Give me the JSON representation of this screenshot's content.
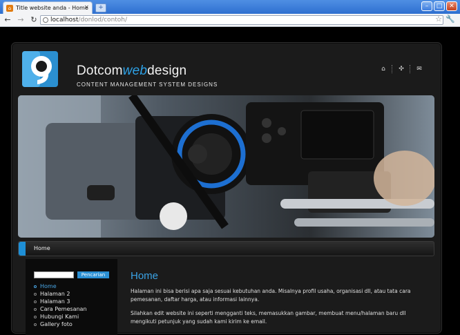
{
  "browser": {
    "tab_title": "Title website anda - Home",
    "tab_close": "×",
    "new_tab": "+",
    "url_host": "localhost",
    "url_path": "/donlod/contoh/",
    "back": "←",
    "forward": "→",
    "reload": "↻",
    "star": "☆",
    "wrench": "🔧",
    "minimize": "–",
    "maximize": "□",
    "close": "✕"
  },
  "site": {
    "brand_pre": "Dotcom",
    "brand_web": "web",
    "brand_post": "design",
    "tagline": "CONTENT MANAGEMENT SYSTEM DESIGNS",
    "header_icons": [
      "⌂",
      "✣",
      "✉"
    ]
  },
  "menu": {
    "home": "Home"
  },
  "sidebar": {
    "search_button": "Pencarian",
    "nav": [
      "Home",
      "Halaman 2",
      "Halaman 3",
      "Cara Pemesanan",
      "Hubungi Kami",
      "Gallery foto"
    ]
  },
  "content": {
    "title": "Home",
    "para1": "Halaman ini bisa berisi apa saja sesuai kebutuhan anda. Misalnya profil usaha, organisasi dll, atau tata cara pemesanan, daftar harga, atau informasi lainnya.",
    "para2": "Silahkan edit website ini seperti mengganti teks, memasukkan gambar, membuat menu/halaman baru dll mengikuti petunjuk yang sudah kami kirim ke email."
  },
  "colors": {
    "accent": "#2da1e6",
    "background": "#000000",
    "panel": "#1b1b1b"
  }
}
